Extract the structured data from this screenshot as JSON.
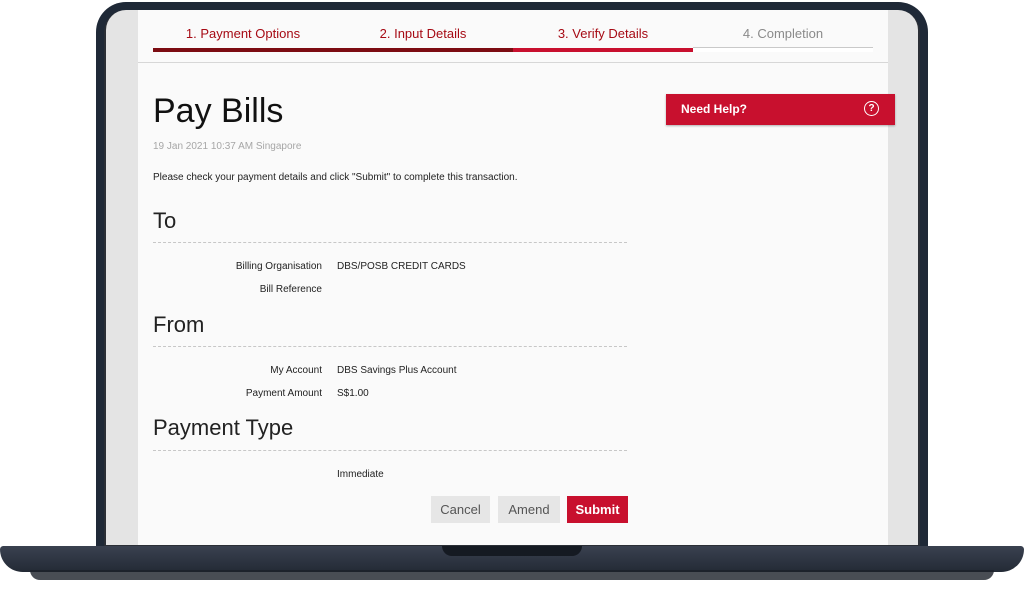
{
  "steps": [
    "1. Payment Options",
    "2. Input Details",
    "3. Verify Details",
    "4. Completion"
  ],
  "page_title": "Pay Bills",
  "timestamp": "19 Jan 2021 10:37 AM Singapore",
  "instruction": "Please check your payment details and click \"Submit\" to complete this transaction.",
  "to": {
    "title": "To",
    "rows": [
      {
        "label": "Billing Organisation",
        "value": "DBS/POSB CREDIT CARDS"
      },
      {
        "label": "Bill Reference",
        "value": ""
      }
    ]
  },
  "from": {
    "title": "From",
    "rows": [
      {
        "label": "My Account",
        "value": "DBS Savings Plus Account"
      },
      {
        "label": "Payment Amount",
        "value": "S$1.00"
      }
    ]
  },
  "payment_type": {
    "title": "Payment Type",
    "value": "Immediate"
  },
  "buttons": {
    "cancel": "Cancel",
    "amend": "Amend",
    "submit": "Submit"
  },
  "help": {
    "label": "Need Help?",
    "icon_glyph": "?"
  },
  "colors": {
    "brand_red": "#c8102e",
    "dark_red": "#7c0c12"
  }
}
